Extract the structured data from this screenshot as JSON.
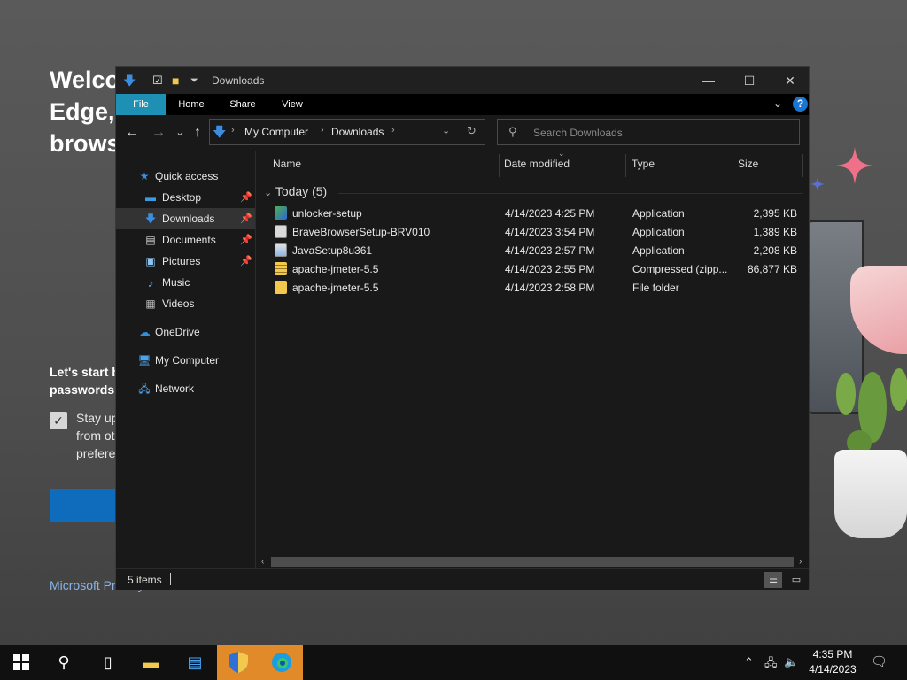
{
  "edge_background": {
    "heading_lines": [
      "Welcome to Microsoft",
      "Edge, the",
      "browser"
    ],
    "subtext_lines": [
      "Let's start by",
      "passwords,"
    ],
    "checkbox_lines": [
      "Stay up to date",
      "from other",
      "preferences"
    ],
    "privacy_link": "Microsoft Privacy Statement"
  },
  "window": {
    "title": "Downloads",
    "controls": {
      "minimize": "—",
      "maximize": "☐",
      "close": "✕"
    }
  },
  "ribbon": {
    "tabs": [
      "File",
      "Home",
      "Share",
      "View"
    ],
    "help": "?"
  },
  "address": {
    "crumbs": [
      "My Computer",
      "Downloads"
    ],
    "search_placeholder": "Search Downloads"
  },
  "nav_pane": {
    "quick_access": "Quick access",
    "items": [
      {
        "label": "Desktop",
        "pinned": true
      },
      {
        "label": "Downloads",
        "pinned": true,
        "selected": true
      },
      {
        "label": "Documents",
        "pinned": true
      },
      {
        "label": "Pictures",
        "pinned": true
      },
      {
        "label": "Music",
        "pinned": false
      },
      {
        "label": "Videos",
        "pinned": false
      }
    ],
    "onedrive": "OneDrive",
    "my_computer": "My Computer",
    "network": "Network"
  },
  "columns": [
    "Name",
    "Date modified",
    "Type",
    "Size"
  ],
  "group": {
    "label": "Today (5)"
  },
  "files": [
    {
      "name": "unlocker-setup",
      "date": "4/14/2023 4:25 PM",
      "type": "Application",
      "size": "2,395 KB",
      "icon": "installer-icon"
    },
    {
      "name": "BraveBrowserSetup-BRV010",
      "date": "4/14/2023 3:54 PM",
      "type": "Application",
      "size": "1,389 KB",
      "icon": "application-icon"
    },
    {
      "name": "JavaSetup8u361",
      "date": "4/14/2023 2:57 PM",
      "type": "Application",
      "size": "2,208 KB",
      "icon": "java-installer-icon"
    },
    {
      "name": "apache-jmeter-5.5",
      "date": "4/14/2023 2:55 PM",
      "type": "Compressed (zipp...",
      "size": "86,877 KB",
      "icon": "zip-folder-icon"
    },
    {
      "name": "apache-jmeter-5.5",
      "date": "4/14/2023 2:58 PM",
      "type": "File folder",
      "size": "",
      "icon": "folder-icon"
    }
  ],
  "status": {
    "items_count": "5 items"
  },
  "taskbar": {
    "time": "4:35 PM",
    "date": "4/14/2023"
  }
}
